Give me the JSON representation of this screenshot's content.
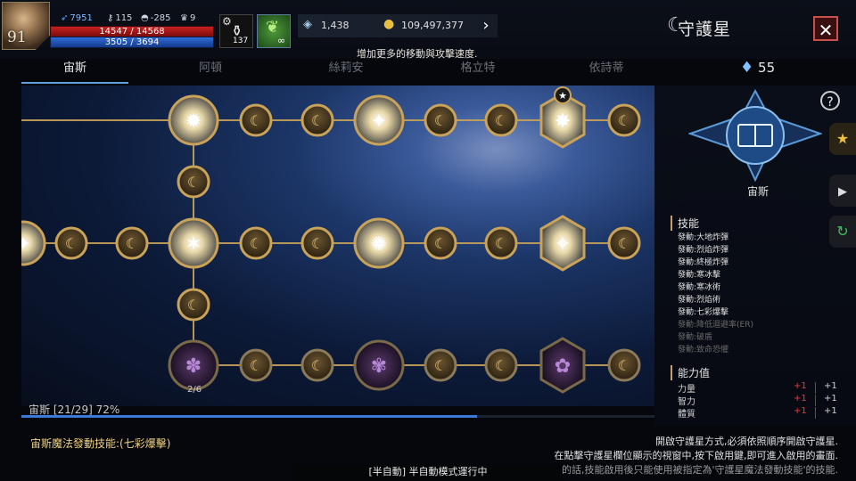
{
  "player": {
    "level": "91",
    "stats": [
      {
        "icon": "wing-icon",
        "value": "7951"
      },
      {
        "icon": "key-icon",
        "value": "115"
      },
      {
        "icon": "helmet-icon",
        "value": "-285"
      },
      {
        "icon": "trophy-icon",
        "value": "9"
      }
    ],
    "hp_text": "14547 / 14568",
    "hp_fraction": 0.998,
    "mp_text": "3505 / 3694",
    "mp_fraction": 0.949
  },
  "buff": {
    "count": "137"
  },
  "currency": {
    "gems": "1,438",
    "gold": "109,497,377"
  },
  "hint": "增加更多的移動與攻擊速度.",
  "title": "守護星",
  "tabs": [
    {
      "label": "宙斯",
      "active": true
    },
    {
      "label": "阿頓",
      "active": false
    },
    {
      "label": "絲莉安",
      "active": false
    },
    {
      "label": "格立特",
      "active": false
    },
    {
      "label": "依詩蒂",
      "active": false
    }
  ],
  "crystal_count": "55",
  "board": {
    "node_counter": "2/6",
    "progress_label": "宙斯 [21/29] 72%",
    "progress_fraction": 0.72
  },
  "panel": {
    "name": "宙斯",
    "skills_heading": "技能",
    "skills": [
      {
        "text": "發動:大地炸彈",
        "active": true
      },
      {
        "text": "發動:烈焰炸彈",
        "active": true
      },
      {
        "text": "發動:終極炸彈",
        "active": true
      },
      {
        "text": "發動:寒冰擊",
        "active": true
      },
      {
        "text": "發動:寒冰術",
        "active": true
      },
      {
        "text": "發動:烈焰術",
        "active": true
      },
      {
        "text": "發動:七彩爆擊",
        "active": true
      },
      {
        "text": "發動:降低迴避率(ER)",
        "active": false
      },
      {
        "text": "發動:破盾",
        "active": false
      },
      {
        "text": "發動:致命恐懼",
        "active": false
      }
    ],
    "attr_heading": "能力值",
    "attrs": [
      {
        "name": "力量",
        "bonus": "+1",
        "total": "+1"
      },
      {
        "name": "智力",
        "bonus": "+1",
        "total": "+1"
      },
      {
        "name": "體質",
        "bonus": "+1",
        "total": "+1"
      }
    ]
  },
  "bottom": {
    "magic_skill": "宙斯魔法發動技能:(七彩爆擊)",
    "desc": [
      "開啟守護星方式,必須依照順序開啟守護星.",
      "在點擊守護星欄位顯示的視窗中,按下啟用鍵,即可進入啟用的畫面.",
      "發動技能的話,技能啟用後只能使用被指定為'守護星魔法發動技能'的技能."
    ],
    "auto_mode": "[半自動] 半自動模式運行中"
  },
  "colors": {
    "gold": "#c9a35a",
    "hp": "#c92020",
    "mp": "#2e6bd8",
    "progress": "#3b7ad6",
    "bonus": "#e04040"
  }
}
